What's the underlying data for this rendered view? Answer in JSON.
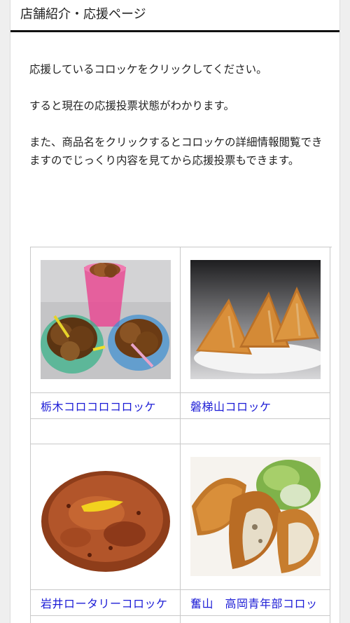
{
  "header": {
    "title": "店舗紹介・応援ページ"
  },
  "intro": {
    "lines": [
      "応援しているコロッケをクリックしてください。",
      "すると現在の応援投票状態がわかります。",
      "また、商品名をクリックするとコロッケの詳細情報閲覧できますのでじっくり内容を見てから応援投票もできます。"
    ]
  },
  "products": [
    {
      "name": "栃木コロコロコロッケ",
      "image": "croquettes-in-colorful-cups"
    },
    {
      "name": "磐梯山コロッケ",
      "image": "triangle-croquettes-on-plate"
    },
    {
      "name": "岩井ロータリーコロッケ",
      "image": "sauced-round-croquette"
    },
    {
      "name": "奮山　高岡青年部コロッ",
      "image": "croquettes-with-salad"
    }
  ]
}
